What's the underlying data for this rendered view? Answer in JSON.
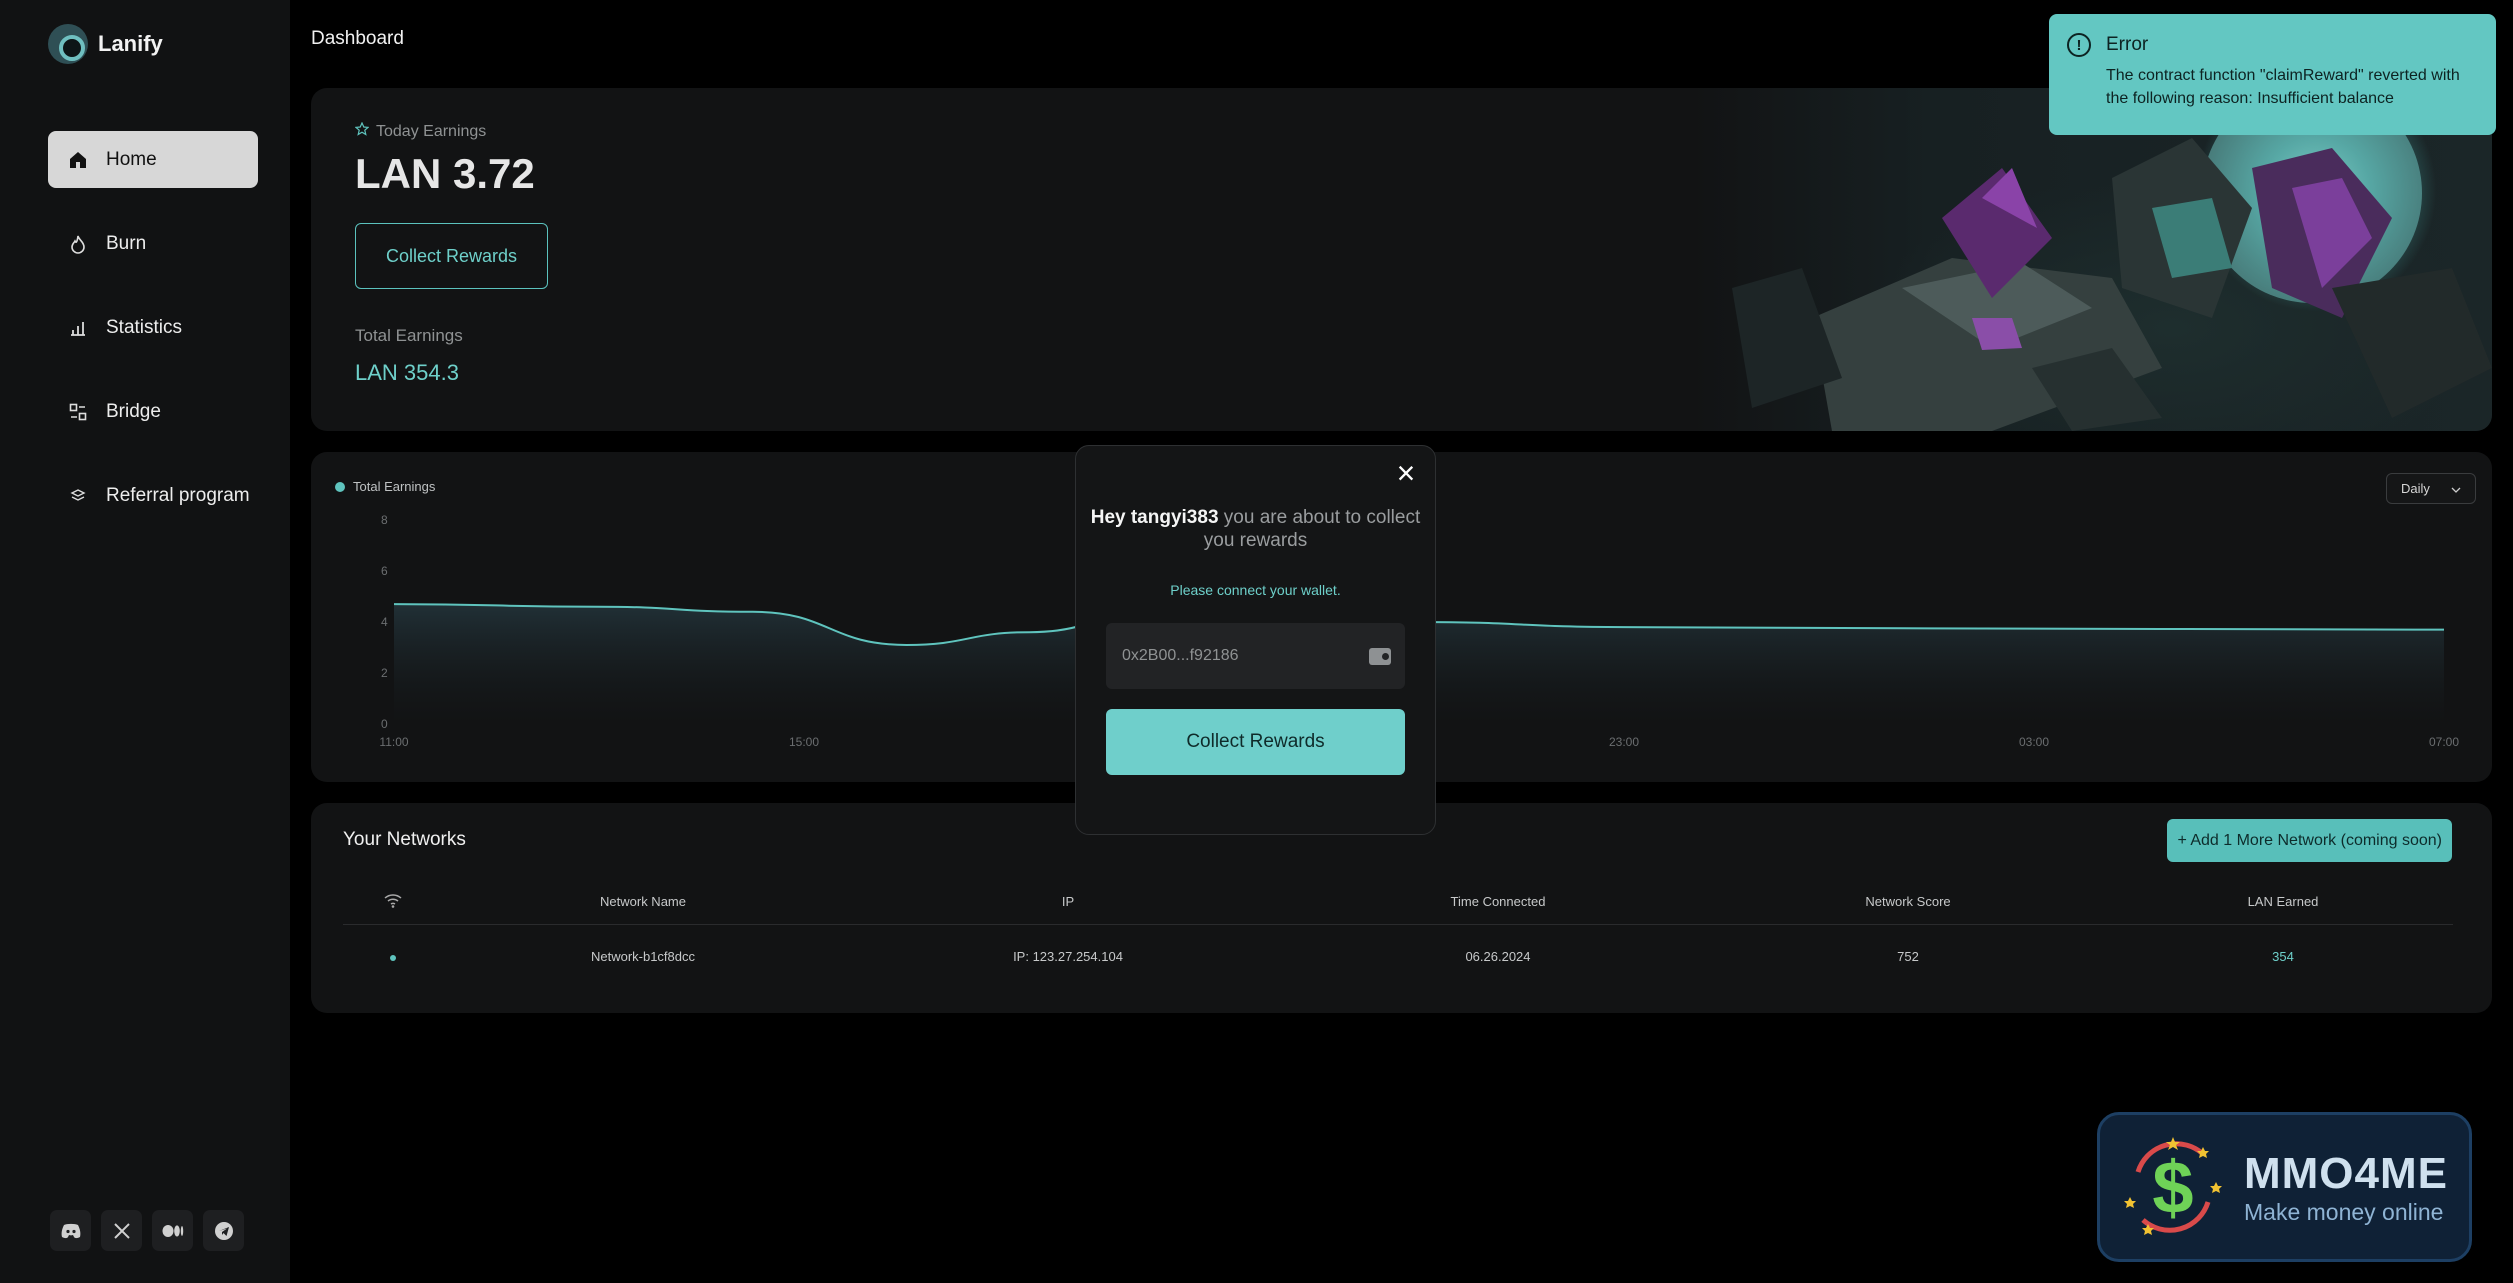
{
  "app": {
    "name": "Lanify",
    "page_title": "Dashboard"
  },
  "sidebar": {
    "items": [
      {
        "label": "Home",
        "icon": "home-icon",
        "active": true
      },
      {
        "label": "Burn",
        "icon": "flame-icon",
        "active": false
      },
      {
        "label": "Statistics",
        "icon": "bar-chart-icon",
        "active": false
      },
      {
        "label": "Bridge",
        "icon": "bridge-icon",
        "active": false
      },
      {
        "label": "Referral program",
        "icon": "layers-icon",
        "active": false
      }
    ],
    "socials": [
      "discord-icon",
      "x-icon",
      "medium-icon",
      "telegram-icon"
    ]
  },
  "earnings": {
    "today_label": "Today Earnings",
    "today_value": "LAN 3.72",
    "collect_label": "Collect Rewards",
    "total_label": "Total Earnings",
    "total_value": "LAN 354.3"
  },
  "chart_data": {
    "type": "area",
    "legend": "Total Earnings",
    "period_select": "Daily",
    "x_ticks": [
      "11:00",
      "15:00",
      "23:00",
      "03:00",
      "07:00"
    ],
    "y_ticks": [
      "0",
      "2",
      "4",
      "6",
      "8"
    ],
    "ylim": [
      0,
      8
    ],
    "points": [
      {
        "x": 0,
        "y": 4.7
      },
      {
        "x": 2,
        "y": 4.6
      },
      {
        "x": 3.5,
        "y": 4.4
      },
      {
        "x": 5,
        "y": 3.1
      },
      {
        "x": 6.2,
        "y": 3.6
      },
      {
        "x": 8,
        "y": 5.5
      },
      {
        "x": 10,
        "y": 4.0
      },
      {
        "x": 12,
        "y": 3.8
      },
      {
        "x": 15,
        "y": 3.75
      },
      {
        "x": 20,
        "y": 3.7
      }
    ],
    "x_tick_positions": [
      0,
      4,
      12,
      16,
      20
    ],
    "xlim": [
      0,
      20
    ]
  },
  "networks": {
    "title": "Your Networks",
    "add_label": "+ Add 1 More Network (coming soon)",
    "columns": [
      "Network Name",
      "IP",
      "Time Connected",
      "Network Score",
      "LAN Earned"
    ],
    "rows": [
      {
        "name": "Network-b1cf8dcc",
        "ip": "IP: 123.27.254.104",
        "time": "06.26.2024",
        "score": "752",
        "earned": "354"
      }
    ]
  },
  "modal": {
    "greeting_bold": "Hey tangyi383",
    "greeting_rest": " you are about to collect you rewards",
    "sub": "Please connect your wallet.",
    "wallet_value": "0x2B00...f92186",
    "button": "Collect Rewards",
    "close": "×"
  },
  "toast": {
    "title": "Error",
    "message": "The contract function \"claimReward\" reverted with the following reason: Insufficient balance"
  },
  "watermark": {
    "big": "MMO4ME",
    "small": "Make money online"
  }
}
